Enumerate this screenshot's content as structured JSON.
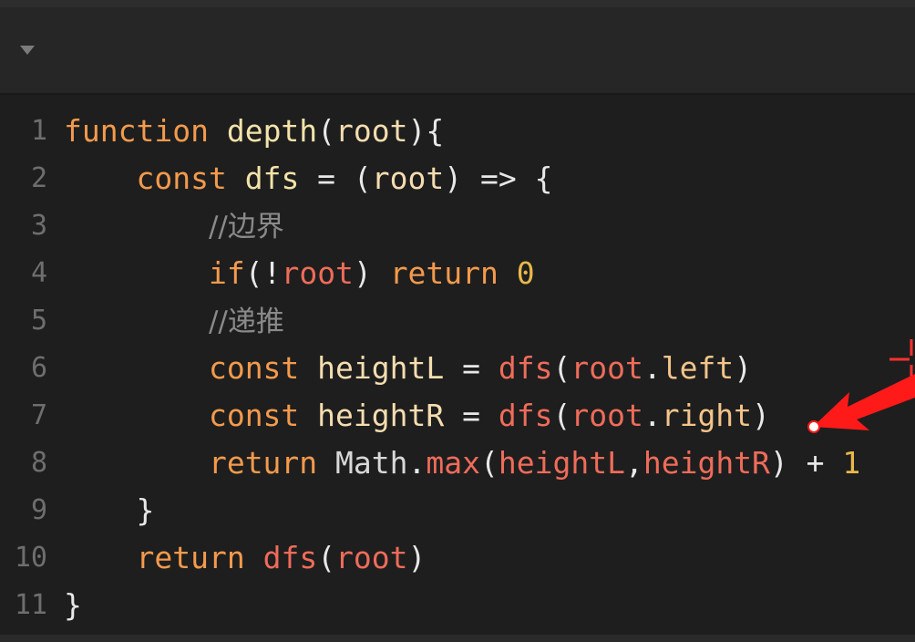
{
  "editor": {
    "lines": [
      {
        "n": "1",
        "tokens": [
          {
            "t": "function",
            "c": "kw"
          },
          {
            "t": " ",
            "c": "op"
          },
          {
            "t": "depth",
            "c": "fn"
          },
          {
            "t": "(",
            "c": "op"
          },
          {
            "t": "root",
            "c": "var"
          },
          {
            "t": "){",
            "c": "op"
          }
        ]
      },
      {
        "n": "2",
        "tokens": [
          {
            "t": "    ",
            "c": "op"
          },
          {
            "t": "const",
            "c": "kw"
          },
          {
            "t": " ",
            "c": "op"
          },
          {
            "t": "dfs",
            "c": "fn"
          },
          {
            "t": " = (",
            "c": "op"
          },
          {
            "t": "root",
            "c": "var"
          },
          {
            "t": ") => {",
            "c": "op"
          }
        ]
      },
      {
        "n": "3",
        "tokens": [
          {
            "t": "        ",
            "c": "op"
          },
          {
            "t": "//边界",
            "c": "cm"
          }
        ]
      },
      {
        "n": "4",
        "tokens": [
          {
            "t": "        ",
            "c": "op"
          },
          {
            "t": "if",
            "c": "kw"
          },
          {
            "t": "(!",
            "c": "op"
          },
          {
            "t": "root",
            "c": "rc"
          },
          {
            "t": ") ",
            "c": "op"
          },
          {
            "t": "return",
            "c": "kw"
          },
          {
            "t": " ",
            "c": "op"
          },
          {
            "t": "0",
            "c": "num"
          }
        ]
      },
      {
        "n": "5",
        "tokens": [
          {
            "t": "        ",
            "c": "op"
          },
          {
            "t": "//递推",
            "c": "cm"
          }
        ]
      },
      {
        "n": "6",
        "tokens": [
          {
            "t": "        ",
            "c": "op"
          },
          {
            "t": "const",
            "c": "kw"
          },
          {
            "t": " ",
            "c": "op"
          },
          {
            "t": "heightL",
            "c": "var"
          },
          {
            "t": " = ",
            "c": "op"
          },
          {
            "t": "dfs",
            "c": "call"
          },
          {
            "t": "(",
            "c": "op"
          },
          {
            "t": "root",
            "c": "rc"
          },
          {
            "t": ".",
            "c": "op"
          },
          {
            "t": "left",
            "c": "prop"
          },
          {
            "t": ")",
            "c": "op"
          }
        ]
      },
      {
        "n": "7",
        "tokens": [
          {
            "t": "        ",
            "c": "op"
          },
          {
            "t": "const",
            "c": "kw"
          },
          {
            "t": " ",
            "c": "op"
          },
          {
            "t": "heightR",
            "c": "var"
          },
          {
            "t": " = ",
            "c": "op"
          },
          {
            "t": "dfs",
            "c": "call"
          },
          {
            "t": "(",
            "c": "op"
          },
          {
            "t": "root",
            "c": "rc"
          },
          {
            "t": ".",
            "c": "op"
          },
          {
            "t": "right",
            "c": "prop"
          },
          {
            "t": ")",
            "c": "op"
          }
        ]
      },
      {
        "n": "8",
        "tokens": [
          {
            "t": "        ",
            "c": "op"
          },
          {
            "t": "return",
            "c": "kw"
          },
          {
            "t": " ",
            "c": "op"
          },
          {
            "t": "Math",
            "c": "cls"
          },
          {
            "t": ".",
            "c": "op"
          },
          {
            "t": "max",
            "c": "call"
          },
          {
            "t": "(",
            "c": "op"
          },
          {
            "t": "heightL",
            "c": "rc"
          },
          {
            "t": ",",
            "c": "op"
          },
          {
            "t": "heightR",
            "c": "rc"
          },
          {
            "t": ") + ",
            "c": "op"
          },
          {
            "t": "1",
            "c": "num"
          }
        ]
      },
      {
        "n": "9",
        "tokens": [
          {
            "t": "    ",
            "c": "op"
          },
          {
            "t": "}",
            "c": "op"
          }
        ]
      },
      {
        "n": "10",
        "tokens": [
          {
            "t": "    ",
            "c": "op"
          },
          {
            "t": "return",
            "c": "kw"
          },
          {
            "t": " ",
            "c": "op"
          },
          {
            "t": "dfs",
            "c": "call"
          },
          {
            "t": "(",
            "c": "op"
          },
          {
            "t": "root",
            "c": "rc"
          },
          {
            "t": ")",
            "c": "op"
          }
        ]
      },
      {
        "n": "11",
        "tokens": [
          {
            "t": "}",
            "c": "op"
          }
        ]
      }
    ]
  },
  "annotation": {
    "arrow_color": "#ff1a1a"
  },
  "colors": {
    "background": "#1e1e1e",
    "keyword": "#f39a4c",
    "comment": "#8a8a8a",
    "number": "#e8b84a"
  }
}
